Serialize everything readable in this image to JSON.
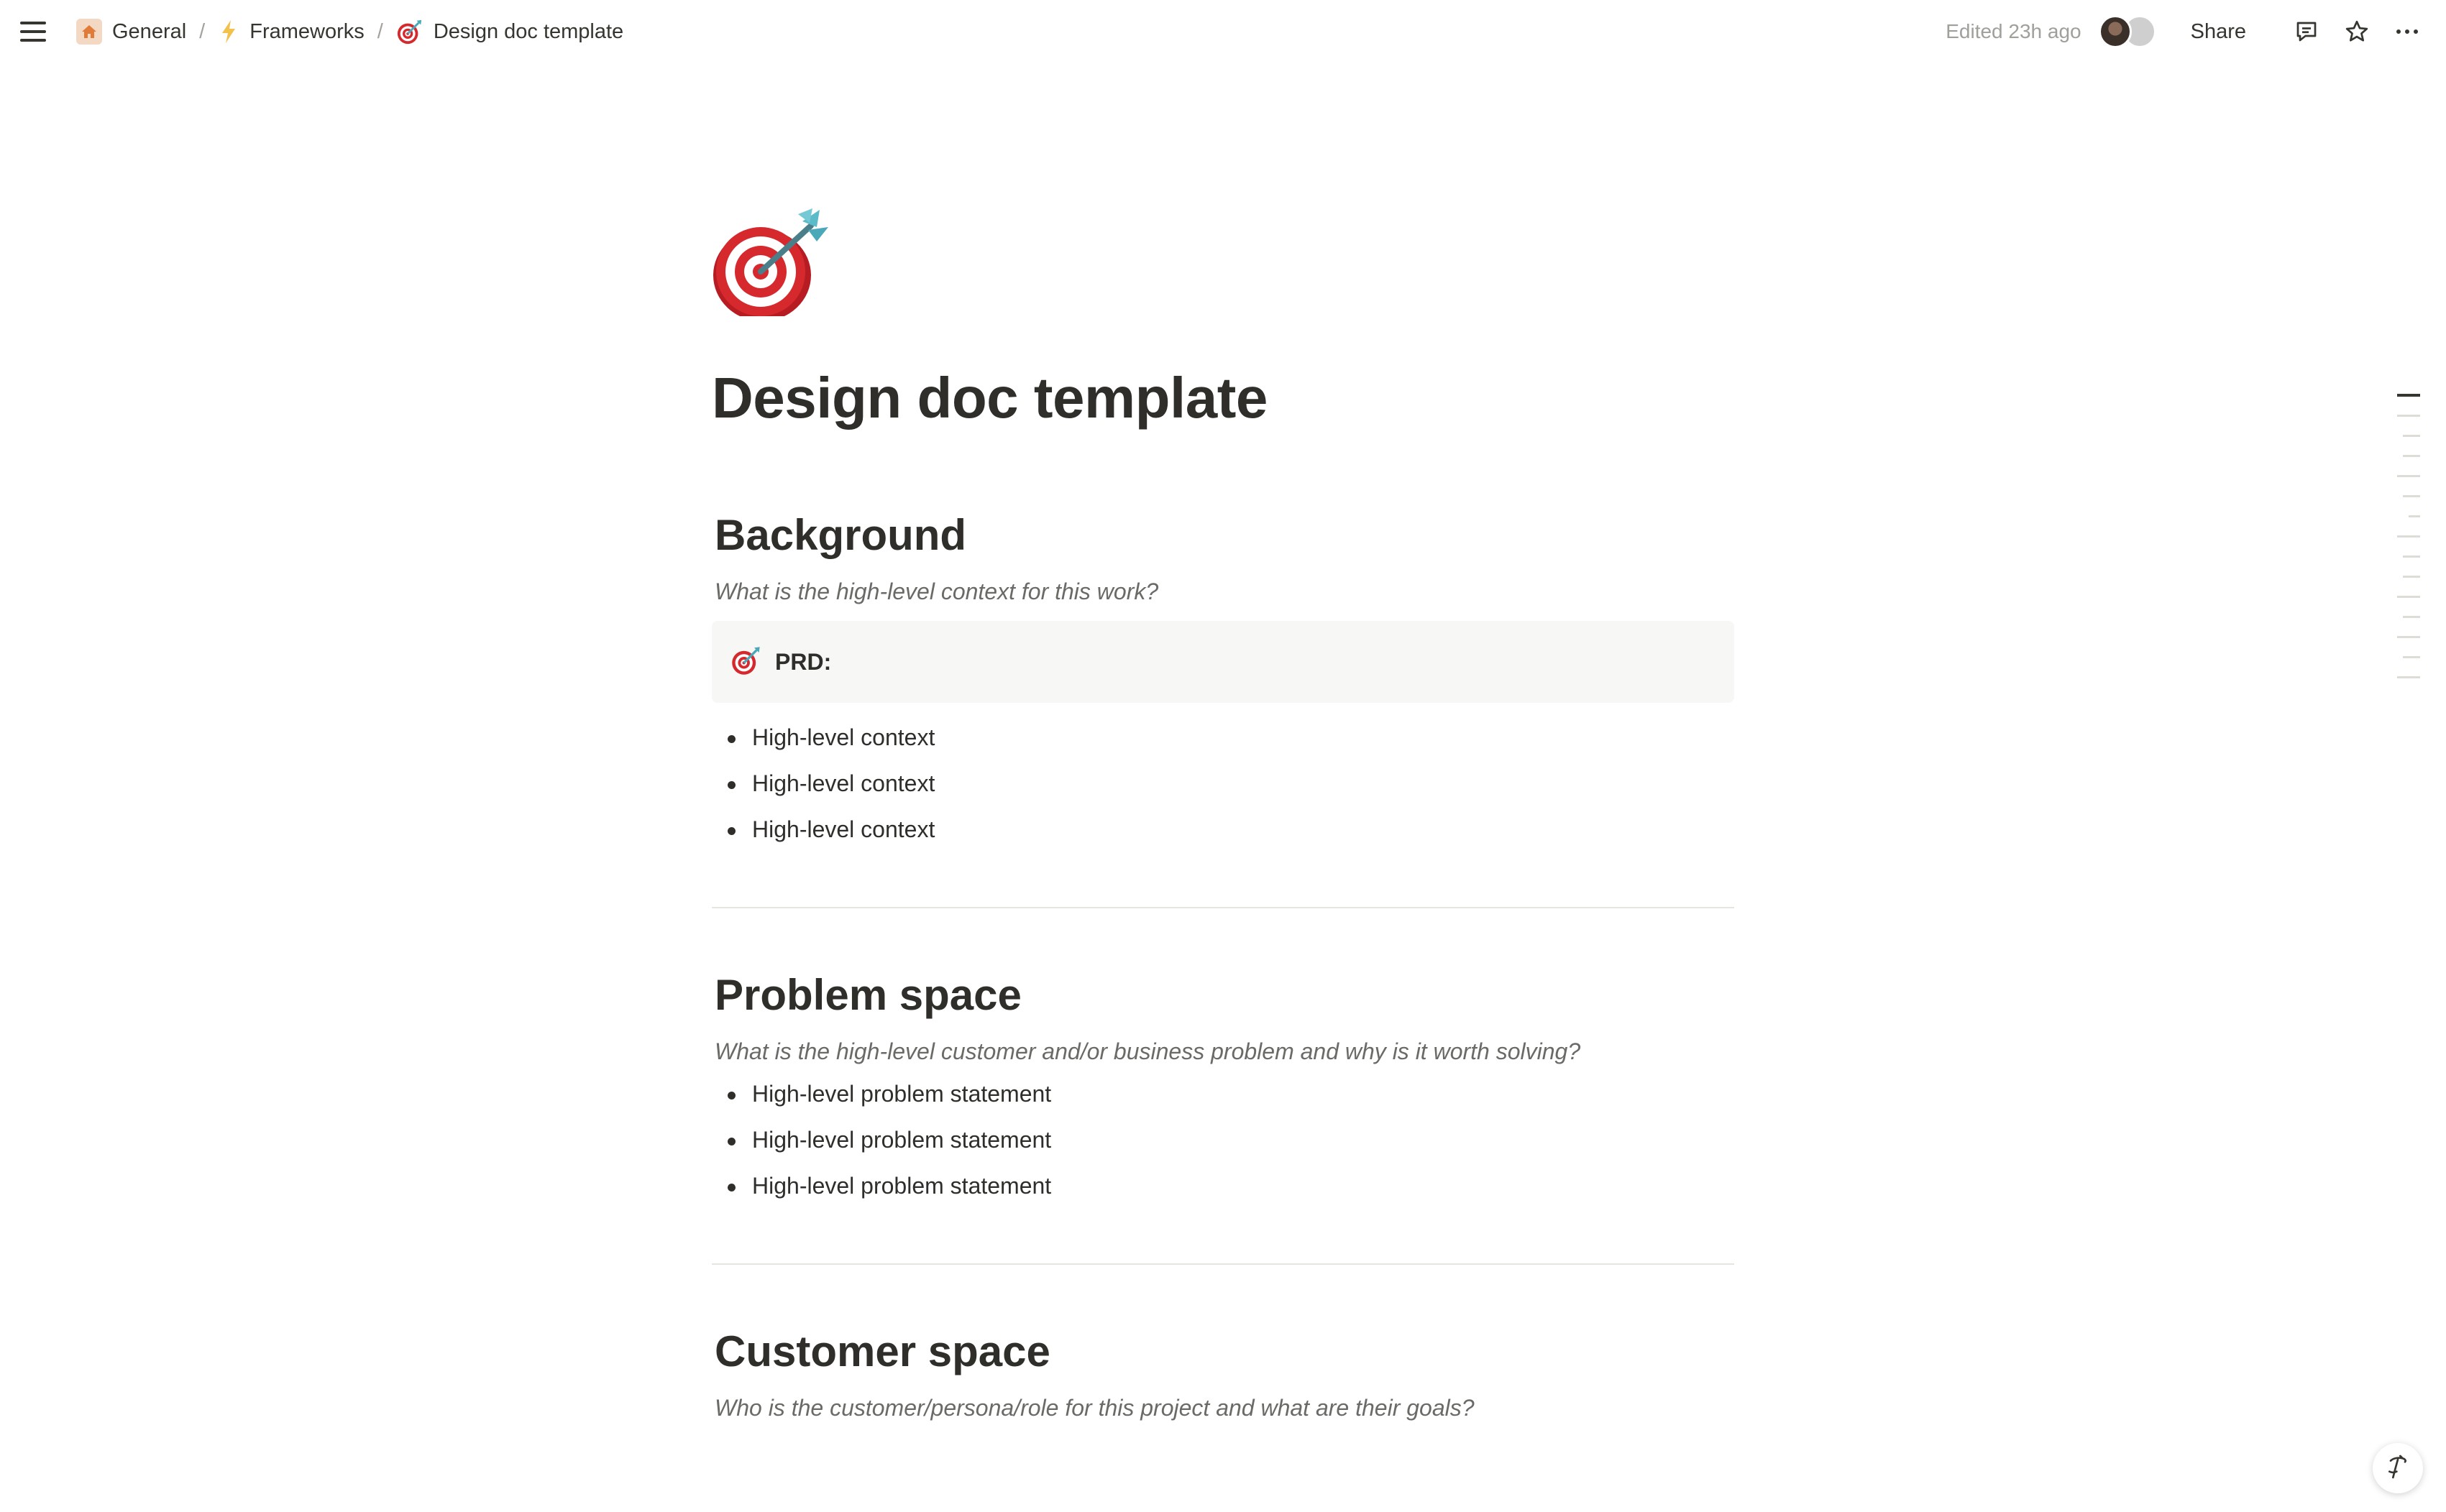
{
  "breadcrumb": {
    "items": [
      {
        "label": "General",
        "icon": "home-icon"
      },
      {
        "label": "Frameworks",
        "icon": "lightning-icon"
      },
      {
        "label": "Design doc template",
        "icon": "target-icon"
      }
    ],
    "separator": "/"
  },
  "header": {
    "edited": "Edited 23h ago",
    "share_label": "Share"
  },
  "page": {
    "icon": "target-icon",
    "title": "Design doc template",
    "sections": [
      {
        "heading": "Background",
        "hint": "What is the high-level context for this work?",
        "callout": {
          "icon": "target-icon",
          "label": "PRD:"
        },
        "bullets": [
          "High-level context",
          "High-level context",
          "High-level context"
        ]
      },
      {
        "heading": "Problem space",
        "hint": "What is the high-level customer and/or business problem and why is it worth solving?",
        "bullets": [
          "High-level problem statement",
          "High-level problem statement",
          "High-level problem statement"
        ]
      },
      {
        "heading": "Customer space",
        "hint": "Who is the customer/persona/role for this project and what are their goals?"
      }
    ]
  },
  "colors": {
    "text": "#37352f",
    "muted": "#a19f9a",
    "callout_bg": "#f7f7f5",
    "divider": "#e6e5e1",
    "target_red": "#d6292e",
    "dart_teal": "#4aa9b8",
    "bolt": "#f2c14e"
  }
}
